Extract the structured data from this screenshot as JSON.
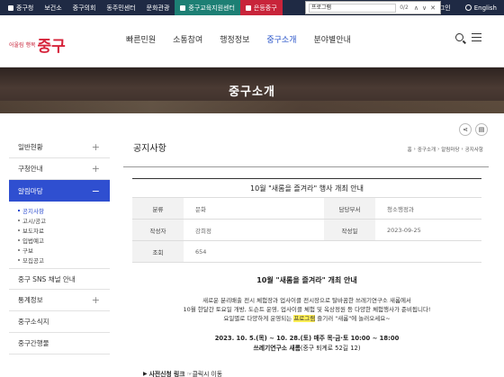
{
  "topbar": {
    "items": [
      "중구청",
      "보건소",
      "중구의회",
      "동주민센터",
      "문화관광"
    ],
    "green_item": "중구교육지원센터",
    "red_item": "은등중구",
    "login": "로그인",
    "language": "English"
  },
  "findbar": {
    "query": "프로그램",
    "count": "0/2",
    "up": "∧",
    "down": "∨",
    "close": "✕"
  },
  "header": {
    "logo_small": "어울림 행복",
    "logo_big": "중구",
    "nav": [
      "빠른민원",
      "소통참여",
      "행정정보",
      "중구소개",
      "분야별안내"
    ],
    "nav_active_index": 3
  },
  "banner": {
    "title": "중구소개"
  },
  "tools": {
    "share_icon": "share-icon",
    "print_icon": "print-icon"
  },
  "sidebar": {
    "items": [
      {
        "label": "일반현황",
        "expanded": false
      },
      {
        "label": "구청안내",
        "expanded": false
      },
      {
        "label": "알림마당",
        "expanded": true
      }
    ],
    "sub_items": [
      "공지사항",
      "고시/공고",
      "보도자료",
      "입법예고",
      "구보",
      "모집공고"
    ],
    "sub_active_index": 0,
    "after_items": [
      {
        "label": "중구 SNS 채널 안내",
        "expanded": false
      },
      {
        "label": "통계정보",
        "expanded": false
      },
      {
        "label": "중구소식지",
        "expanded": false
      },
      {
        "label": "중구간행물",
        "expanded": false
      }
    ]
  },
  "main": {
    "page_title": "공지사항",
    "breadcrumb": [
      "홈",
      "중구소개",
      "알림마당",
      "공지사항"
    ],
    "article": {
      "title": "10월 \"새롬을 즐겨라\" 행사 개최 안내",
      "meta": {
        "category_label": "분류",
        "category_value": "문화",
        "dept_label": "담당부서",
        "dept_value": "청소행정과",
        "author_label": "작성자",
        "author_value": "강희정",
        "date_label": "작성일",
        "date_value": "2023-09-25",
        "views_label": "조회",
        "views_value": "654"
      },
      "content_title": "10월 \"새롬을 즐겨라\" 개최 안내",
      "line1": "새로운 분리배출 전시 체험장과 업사이클 전시장으로 탈바꿈한 쓰레기연구소 새롬에서",
      "line2": "10월 한달간 토요일 개방, 도슨트 운영, 업사이클 체험 및 옥상정원 등 다양한 체험행사가 준비됩니다!",
      "line3_before": "요일별로 다양하게 운영되는 ",
      "line3_highlight": "프로그램",
      "line3_after": " 즐기러 \"새롬\"에 놀러오세요~",
      "date_line": "2023. 10. 5.(목) ~ 10. 28.(토) 매주 목·금·토 10:00 ~ 18:00",
      "place_bold": "쓰레기연구소 새롬",
      "place_normal": "(중구 퇴계로 52길 12)",
      "link_label": "사전신청 링크",
      "link_text": "☞클릭시 이동"
    }
  },
  "colors": {
    "topbar_bg": "#1f2a44",
    "green": "#1d7f74",
    "red": "#c8243a",
    "accent_blue": "#2f4fd0",
    "highlight": "#ffee55"
  }
}
